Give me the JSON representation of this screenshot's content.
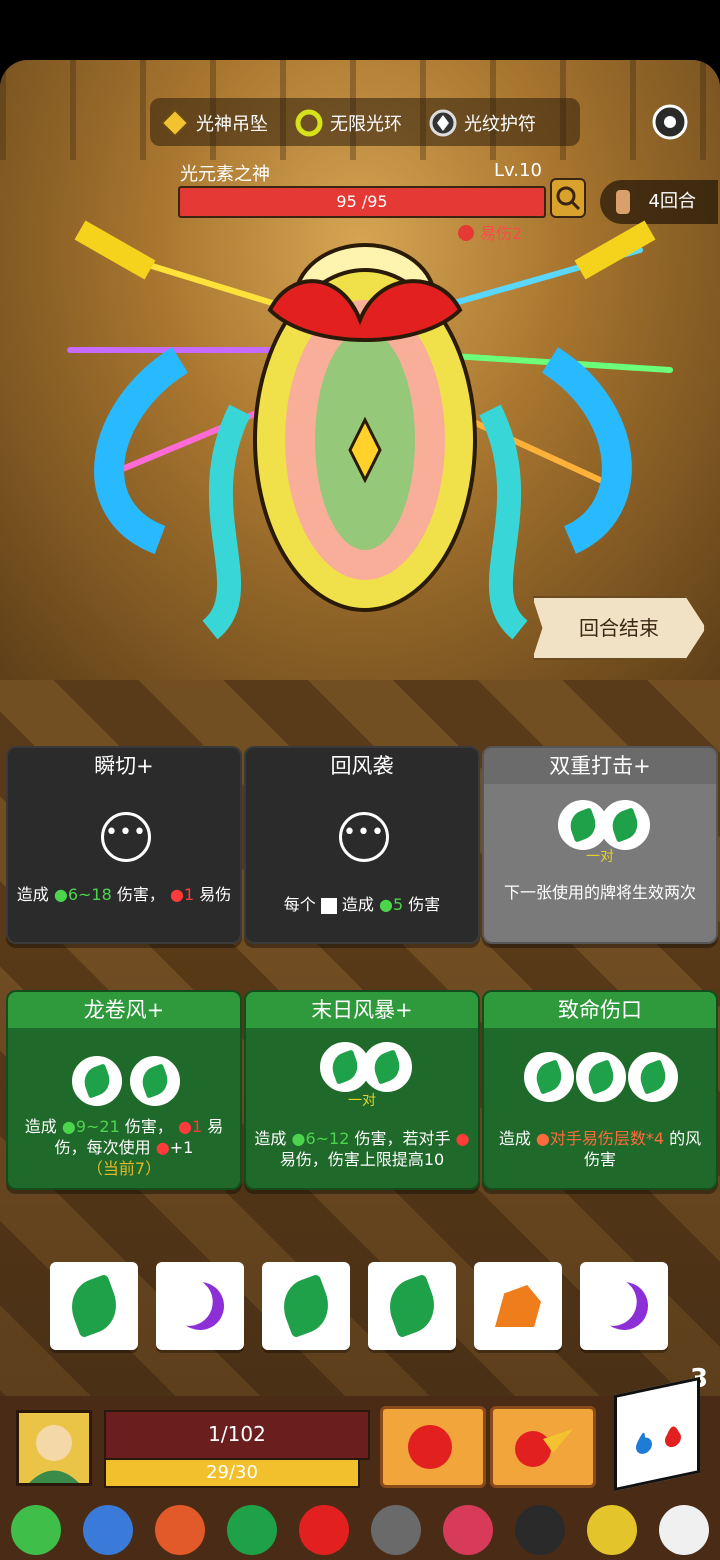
{
  "relics": [
    {
      "icon": "golden-pendant-icon",
      "label": "光神吊坠"
    },
    {
      "icon": "halo-ring-icon",
      "label": "无限光环"
    },
    {
      "icon": "light-amulet-icon",
      "label": "光纹护符"
    }
  ],
  "boss": {
    "name": "光元素之神",
    "level": "Lv.10",
    "hp": "95 /95",
    "status": "易伤2"
  },
  "round": {
    "label": "4回合"
  },
  "end_turn": {
    "label": "回合结束"
  },
  "cards_top": [
    {
      "title": "瞬切+",
      "desc_pre": "造成",
      "dmg": "6~18",
      "desc_mid": "伤害，",
      "vuln": "1",
      "desc_post": "易伤"
    },
    {
      "title": "回风袭",
      "desc_pre": "每个",
      "desc_mid": "造成",
      "dmg": "5",
      "desc_post": "伤害"
    },
    {
      "title": "双重打击+",
      "slot_label": "一对",
      "desc": "下一张使用的牌将生效两次"
    }
  ],
  "cards_bottom": [
    {
      "title": "龙卷风+",
      "desc_pre": "造成",
      "dmg": "9~21",
      "desc_mid": "伤害，",
      "vuln": "1",
      "desc_mid2": "易伤，每次使用",
      "inc": "+1",
      "note": "（当前7）"
    },
    {
      "title": "末日风暴+",
      "slot_label": "一对",
      "desc_pre": "造成",
      "dmg": "6~12",
      "desc_mid": "伤害，若对手",
      "desc_post": "易伤，伤害上限提高10"
    },
    {
      "title": "致命伤口",
      "desc_pre": "造成",
      "highlight": "对手易伤层数*4",
      "desc_post": "的风伤害"
    }
  ],
  "dice": [
    "leaf",
    "moon",
    "leaf",
    "leaf",
    "stone",
    "moon"
  ],
  "dice_count": "3",
  "player": {
    "hp": "1/102",
    "energy": "29/30"
  },
  "colors": {
    "hp_red": "#e53935",
    "card_green": "#2f9a3c",
    "energy_yellow": "#f1c02c"
  }
}
